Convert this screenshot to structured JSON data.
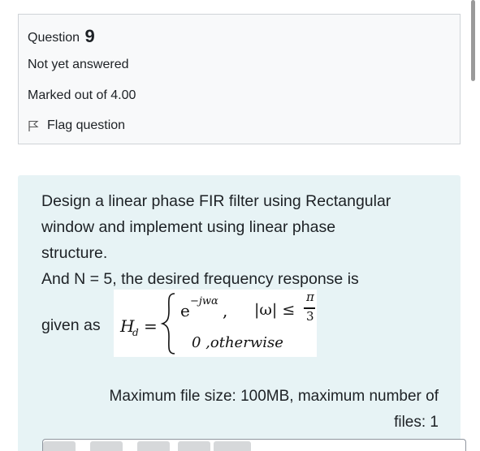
{
  "question": {
    "label": "Question",
    "number": "9",
    "state": "Not yet answered",
    "grade": "Marked out of 4.00",
    "flag_label": "Flag question"
  },
  "text": {
    "line1": "Design a linear phase FIR filter using Rectangular",
    "line2": "window and implement using linear phase",
    "line3": "structure.",
    "line4": "And N = 5, the desired frequency response is",
    "given": "given as"
  },
  "formula": {
    "lhs": "H",
    "lhs_sub": "d",
    "equals": "=",
    "case1_value": "e",
    "case1_exp": "−jwα",
    "case1_comma": ",",
    "case1_cond": "|ω| ≤",
    "pi": "π",
    "three": "3",
    "case2": "0 ,otherwise"
  },
  "upload": {
    "limits_line1": "Maximum file size: 100MB, maximum number of",
    "limits_line2": "files: 1"
  },
  "colors": {
    "info_bg": "#f8f9fa",
    "content_bg": "#e7f3f5",
    "text": "#1d2125"
  }
}
